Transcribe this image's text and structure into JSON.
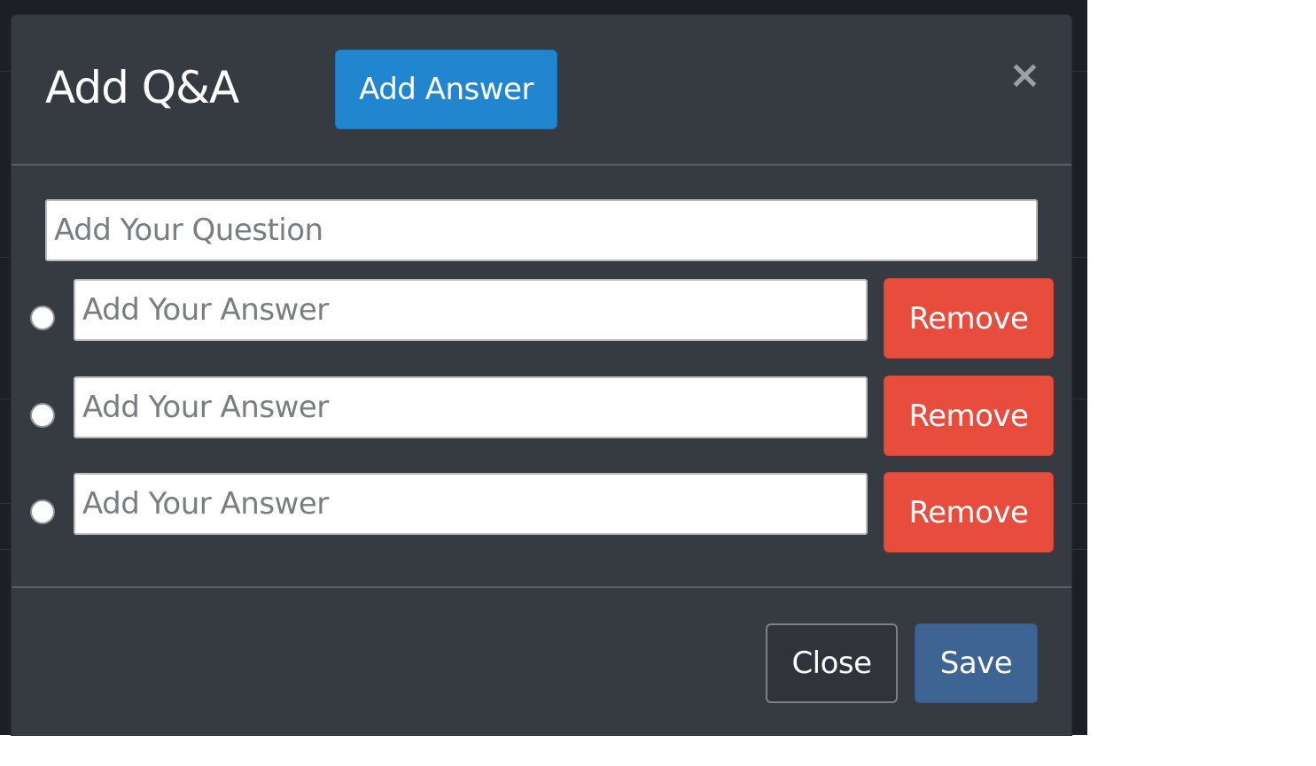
{
  "modal": {
    "title": "Add Q&A",
    "add_answer_label": "Add Answer",
    "close_icon": "×"
  },
  "question": {
    "placeholder": "Add Your Question",
    "value": ""
  },
  "answers": [
    {
      "placeholder": "Add Your Answer",
      "value": "",
      "selected": false,
      "remove_label": "Remove"
    },
    {
      "placeholder": "Add Your Answer",
      "value": "",
      "selected": false,
      "remove_label": "Remove"
    },
    {
      "placeholder": "Add Your Answer",
      "value": "",
      "selected": false,
      "remove_label": "Remove"
    }
  ],
  "footer": {
    "close_label": "Close",
    "save_label": "Save"
  },
  "colors": {
    "modal_background": "#363a41",
    "primary_button": "#2185d0",
    "danger_button": "#e74c3c",
    "save_button": "#3e6494"
  }
}
